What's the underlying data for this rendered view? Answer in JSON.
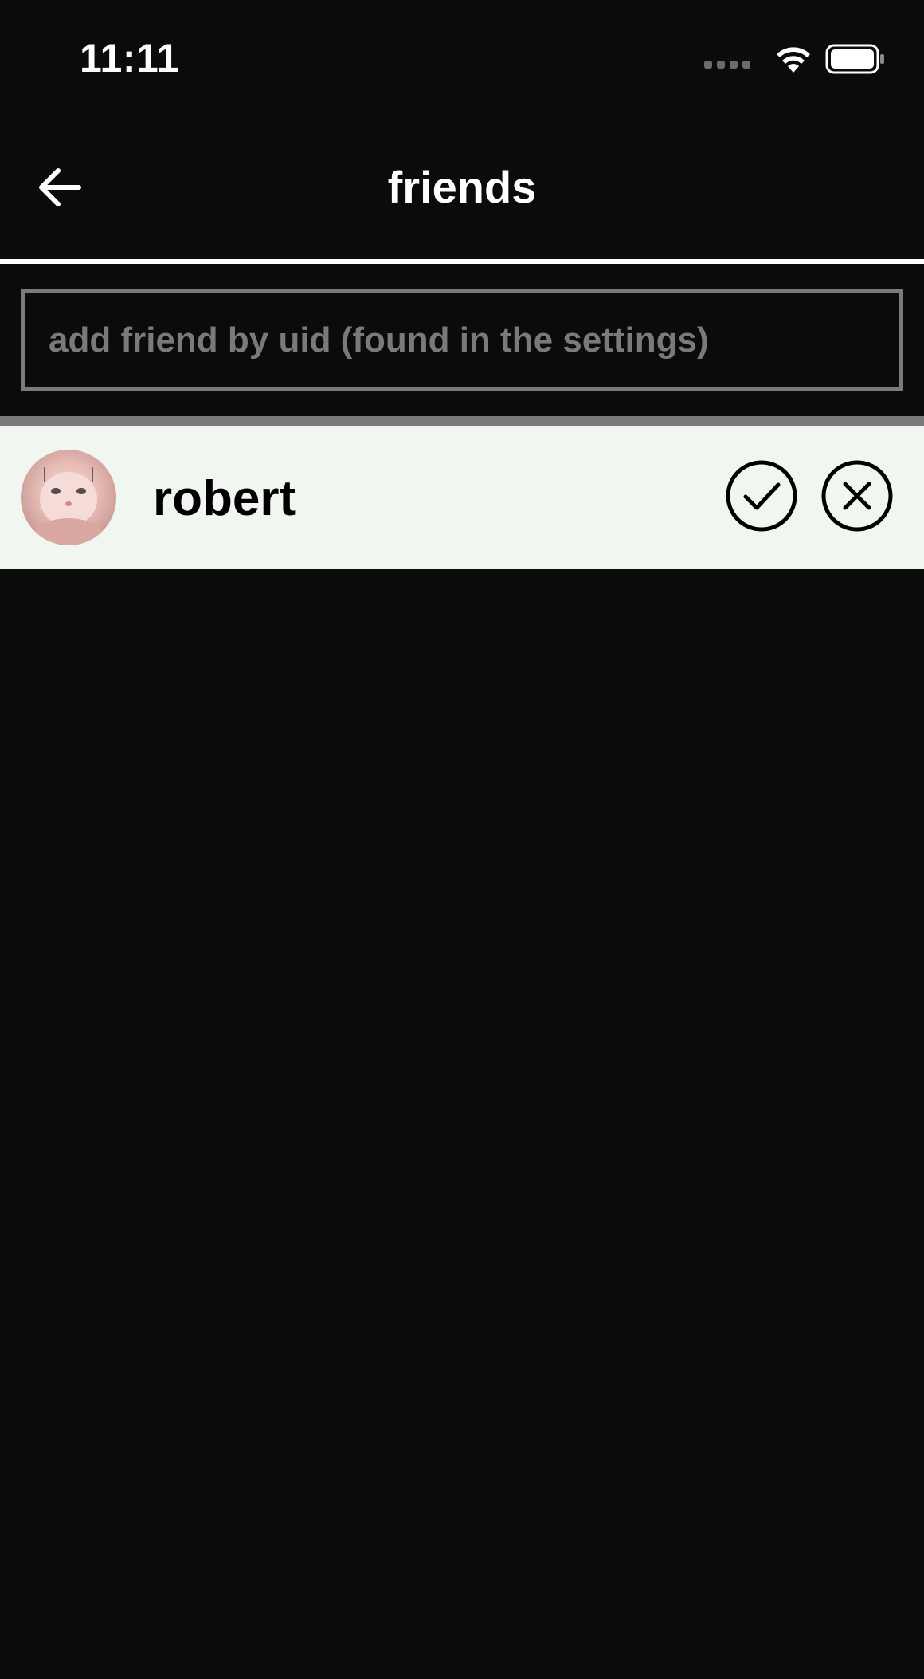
{
  "status_bar": {
    "time": "11:11",
    "icons": [
      "cellular-signal-icon",
      "wifi-icon",
      "battery-icon"
    ]
  },
  "header": {
    "title": "friends",
    "back_icon": "arrow-left-icon"
  },
  "add_friend": {
    "value": "",
    "placeholder": "add friend by uid (found in the settings)"
  },
  "friend_requests": [
    {
      "name": "robert",
      "accept_icon": "check-circle-icon",
      "decline_icon": "close-circle-icon"
    }
  ],
  "colors": {
    "background": "#0b0b0b",
    "row_background": "#f2f6f1",
    "divider": "#ffffff",
    "input_border": "#7a7a7a"
  }
}
